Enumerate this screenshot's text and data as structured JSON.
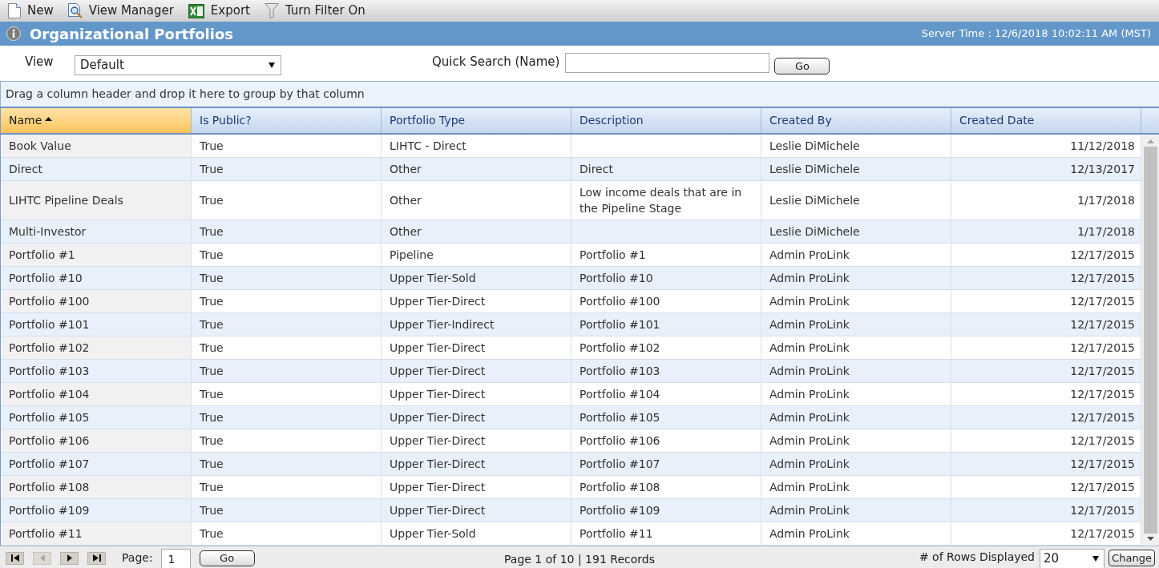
{
  "toolbar": [
    {
      "kind": "new",
      "label": "New"
    },
    {
      "kind": "view-manager",
      "label": "View Manager"
    },
    {
      "kind": "export",
      "label": "Export"
    },
    {
      "kind": "filter",
      "label": "Turn Filter On"
    }
  ],
  "title_bar": {
    "title": "Organizational Portfolios",
    "server_time": "Server Time : 12/6/2018 10:02:11 AM (MST)"
  },
  "filters": {
    "view_label": "View",
    "view_value": "Default",
    "search_label": "Quick Search (Name)",
    "go_button": "Go"
  },
  "group_panel": {
    "hint": "Drag a column header and drop it here to group by that column"
  },
  "table": {
    "columns": [
      {
        "label": "Name",
        "sorted": true
      },
      {
        "label": "Is Public?",
        "sorted": false
      },
      {
        "label": "Portfolio Type",
        "sorted": false
      },
      {
        "label": "Description",
        "sorted": false
      },
      {
        "label": "Created By",
        "sorted": false
      },
      {
        "label": "Created Date",
        "sorted": false
      }
    ],
    "rows": [
      {
        "name": "Book Value",
        "is_public": "True",
        "portfolio_type": "LIHTC - Direct",
        "created_by": "Leslie DiMichele",
        "created_date": "11/12/2018"
      },
      {
        "name": "Direct",
        "is_public": "True",
        "portfolio_type": "Other",
        "description": "Direct",
        "created_by": "Leslie DiMichele",
        "created_date": "12/13/2017"
      },
      {
        "name": "LIHTC Pipeline Deals",
        "is_public": "True",
        "portfolio_type": "Other",
        "description": "Low income deals that are in the Pipeline Stage",
        "created_by": "Leslie DiMichele",
        "created_date": "1/17/2018"
      },
      {
        "name": "Multi-Investor",
        "is_public": "True",
        "portfolio_type": "Other",
        "created_by": "Leslie DiMichele",
        "created_date": "1/17/2018"
      },
      {
        "name": "Portfolio #1",
        "is_public": "True",
        "portfolio_type": "Pipeline",
        "description": "Portfolio #1",
        "created_by": "Admin ProLink",
        "created_date": "12/17/2015"
      },
      {
        "name": "Portfolio #10",
        "is_public": "True",
        "portfolio_type": "Upper Tier-Sold",
        "description": "Portfolio #10",
        "created_by": "Admin ProLink",
        "created_date": "12/17/2015"
      },
      {
        "name": "Portfolio #100",
        "is_public": "True",
        "portfolio_type": "Upper Tier-Direct",
        "description": "Portfolio #100",
        "created_by": "Admin ProLink",
        "created_date": "12/17/2015"
      },
      {
        "name": "Portfolio #101",
        "is_public": "True",
        "portfolio_type": "Upper Tier-Indirect",
        "description": "Portfolio #101",
        "created_by": "Admin ProLink",
        "created_date": "12/17/2015"
      },
      {
        "name": "Portfolio #102",
        "is_public": "True",
        "portfolio_type": "Upper Tier-Direct",
        "description": "Portfolio #102",
        "created_by": "Admin ProLink",
        "created_date": "12/17/2015"
      },
      {
        "name": "Portfolio #103",
        "is_public": "True",
        "portfolio_type": "Upper Tier-Direct",
        "description": "Portfolio #103",
        "created_by": "Admin ProLink",
        "created_date": "12/17/2015"
      },
      {
        "name": "Portfolio #104",
        "is_public": "True",
        "portfolio_type": "Upper Tier-Direct",
        "description": "Portfolio #104",
        "created_by": "Admin ProLink",
        "created_date": "12/17/2015"
      },
      {
        "name": "Portfolio #105",
        "is_public": "True",
        "portfolio_type": "Upper Tier-Direct",
        "description": "Portfolio #105",
        "created_by": "Admin ProLink",
        "created_date": "12/17/2015"
      },
      {
        "name": "Portfolio #106",
        "is_public": "True",
        "portfolio_type": "Upper Tier-Direct",
        "description": "Portfolio #106",
        "created_by": "Admin ProLink",
        "created_date": "12/17/2015"
      },
      {
        "name": "Portfolio #107",
        "is_public": "True",
        "portfolio_type": "Upper Tier-Direct",
        "description": "Portfolio #107",
        "created_by": "Admin ProLink",
        "created_date": "12/17/2015"
      },
      {
        "name": "Portfolio #108",
        "is_public": "True",
        "portfolio_type": "Upper Tier-Direct",
        "description": "Portfolio #108",
        "created_by": "Admin ProLink",
        "created_date": "12/17/2015"
      },
      {
        "name": "Portfolio #109",
        "is_public": "True",
        "portfolio_type": "Upper Tier-Direct",
        "description": "Portfolio #109",
        "created_by": "Admin ProLink",
        "created_date": "12/17/2015"
      },
      {
        "name": "Portfolio #11",
        "is_public": "True",
        "portfolio_type": "Upper Tier-Sold",
        "description": "Portfolio #11",
        "created_by": "Admin ProLink",
        "created_date": "12/17/2015"
      }
    ]
  },
  "pager": {
    "nav": [
      {
        "kind": "first",
        "disabled": false
      },
      {
        "kind": "previous",
        "disabled": true
      },
      {
        "kind": "next",
        "disabled": false
      },
      {
        "kind": "last",
        "disabled": false
      }
    ],
    "page_label": "Page:",
    "page_value": "1",
    "go_button": "Go",
    "summary": "Page 1 of 10 | 191 Records",
    "rows_label": "# of Rows Displayed",
    "rows_value": "20",
    "change_button": "Change"
  }
}
